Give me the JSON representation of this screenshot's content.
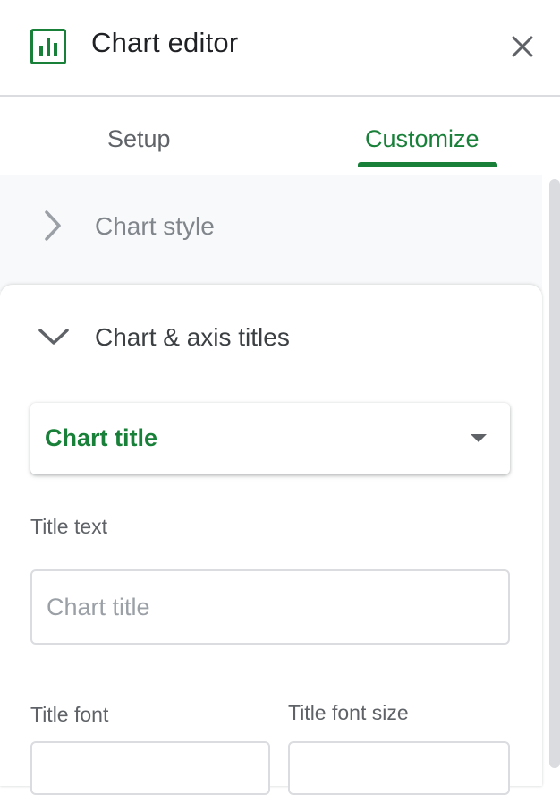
{
  "header": {
    "title": "Chart editor",
    "logo_icon": "bar-chart-icon",
    "close_icon": "close-icon"
  },
  "tabs": [
    {
      "label": "Setup",
      "active": false
    },
    {
      "label": "Customize",
      "active": true
    }
  ],
  "sections": {
    "chart_style": {
      "label": "Chart style",
      "expanded": false,
      "icon": "chevron-right-icon"
    },
    "chart_axis_titles": {
      "label": "Chart & axis titles",
      "expanded": true,
      "icon": "chevron-down-icon",
      "title_type_dropdown": {
        "selected": "Chart title",
        "icon": "dropdown-caret-icon"
      },
      "title_text": {
        "label": "Title text",
        "value": "",
        "placeholder": "Chart title"
      },
      "title_font": {
        "label": "Title font",
        "value": ""
      },
      "title_font_size": {
        "label": "Title font size",
        "value": ""
      }
    }
  },
  "colors": {
    "accent": "#188038",
    "text": "#202124",
    "muted": "#5f6368",
    "border": "#dadce0",
    "panel_bg": "#f8f9fa"
  }
}
